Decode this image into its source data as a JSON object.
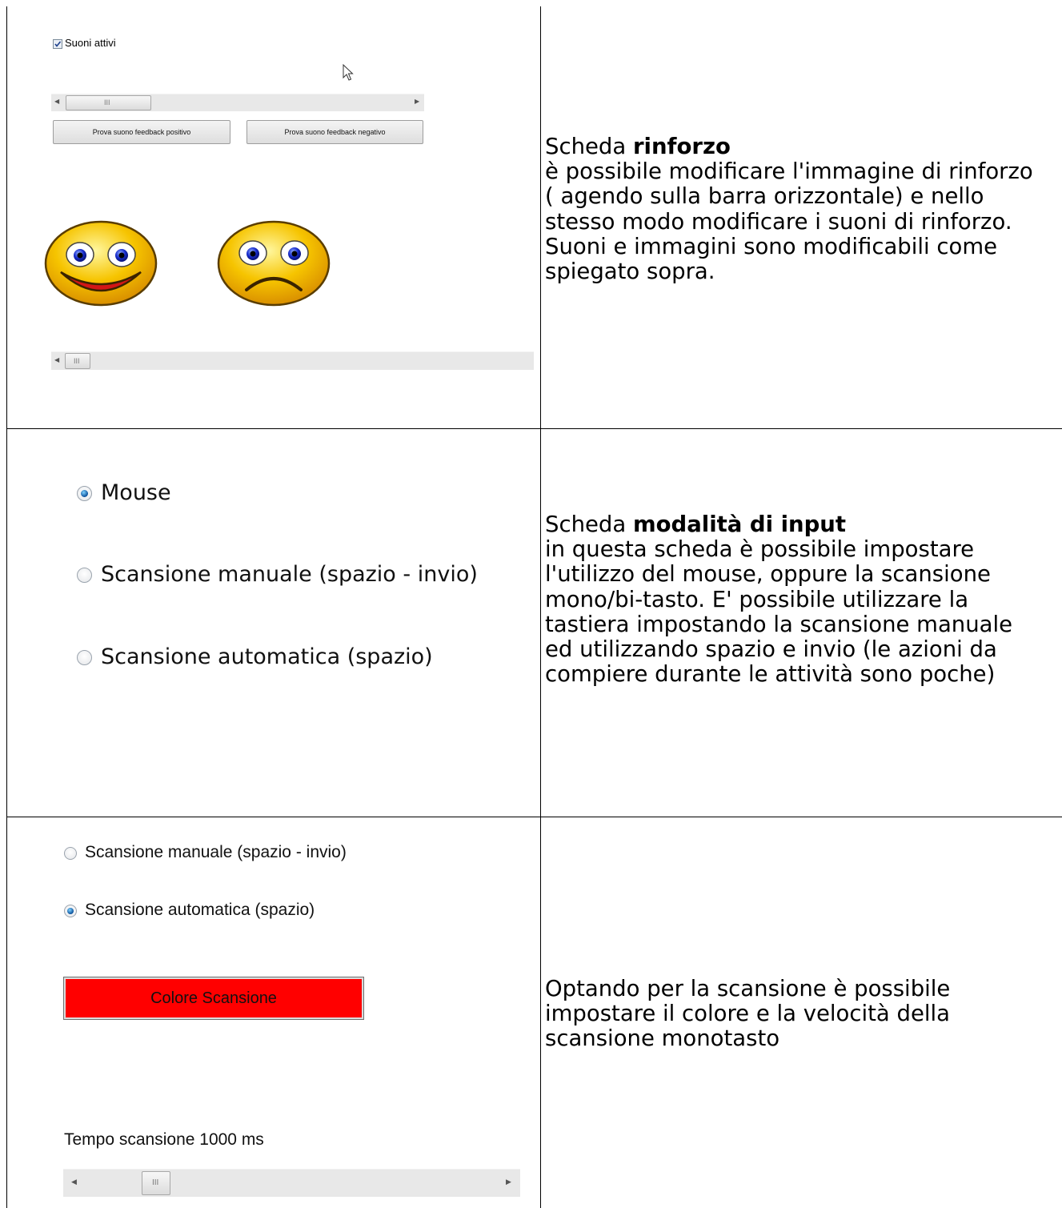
{
  "row1": {
    "checkbox_label": "Suoni attivi",
    "checkbox_checked": true,
    "button_positive": "Prova suono feedback positivo",
    "button_negative": "Prova suono feedback negativo",
    "scrollbar_grip": "III",
    "scrollbar2_grip": "III",
    "description": {
      "line1_prefix": "Scheda ",
      "line1_bold": "rinforzo",
      "lines": [
        "è possibile modificare l'immagine di rinforzo",
        "( agendo sulla barra orizzontale) e nello",
        "stesso modo modificare i suoni di rinforzo.",
        "Suoni e immagini sono modificabili come",
        "spiegato sopra."
      ]
    }
  },
  "row2": {
    "radios": [
      {
        "label": "Mouse",
        "checked": true
      },
      {
        "label": "Scansione manuale (spazio - invio)",
        "checked": false
      },
      {
        "label": "Scansione automatica (spazio)",
        "checked": false
      }
    ],
    "description": {
      "line1_prefix": "Scheda ",
      "line1_bold": "modalità di input",
      "lines": [
        "in questa scheda è possibile impostare",
        "l'utilizzo del mouse, oppure la scansione",
        "mono/bi-tasto. E' possibile utilizzare la",
        "tastiera impostando la scansione manuale",
        "ed utilizzando spazio e invio (le azioni da",
        "compiere durante le attività sono poche)"
      ]
    }
  },
  "row3": {
    "radios": [
      {
        "label": "Scansione manuale (spazio - invio)",
        "checked": false
      },
      {
        "label": "Scansione automatica (spazio)",
        "checked": true
      }
    ],
    "color_button": {
      "label": "Colore Scansione",
      "color": "#ff0000"
    },
    "time_label": "Tempo scansione 1000 ms",
    "scrollbar_grip": "III",
    "description": {
      "lines": [
        "Optando per la scansione è possibile",
        "impostare il colore e la velocità della",
        "scansione monotasto"
      ]
    }
  },
  "colors": {
    "border": "#000000",
    "smiley_fill": "#f6c400",
    "smiley_outline": "#6b4a00",
    "scan_color": "#ff0000"
  }
}
